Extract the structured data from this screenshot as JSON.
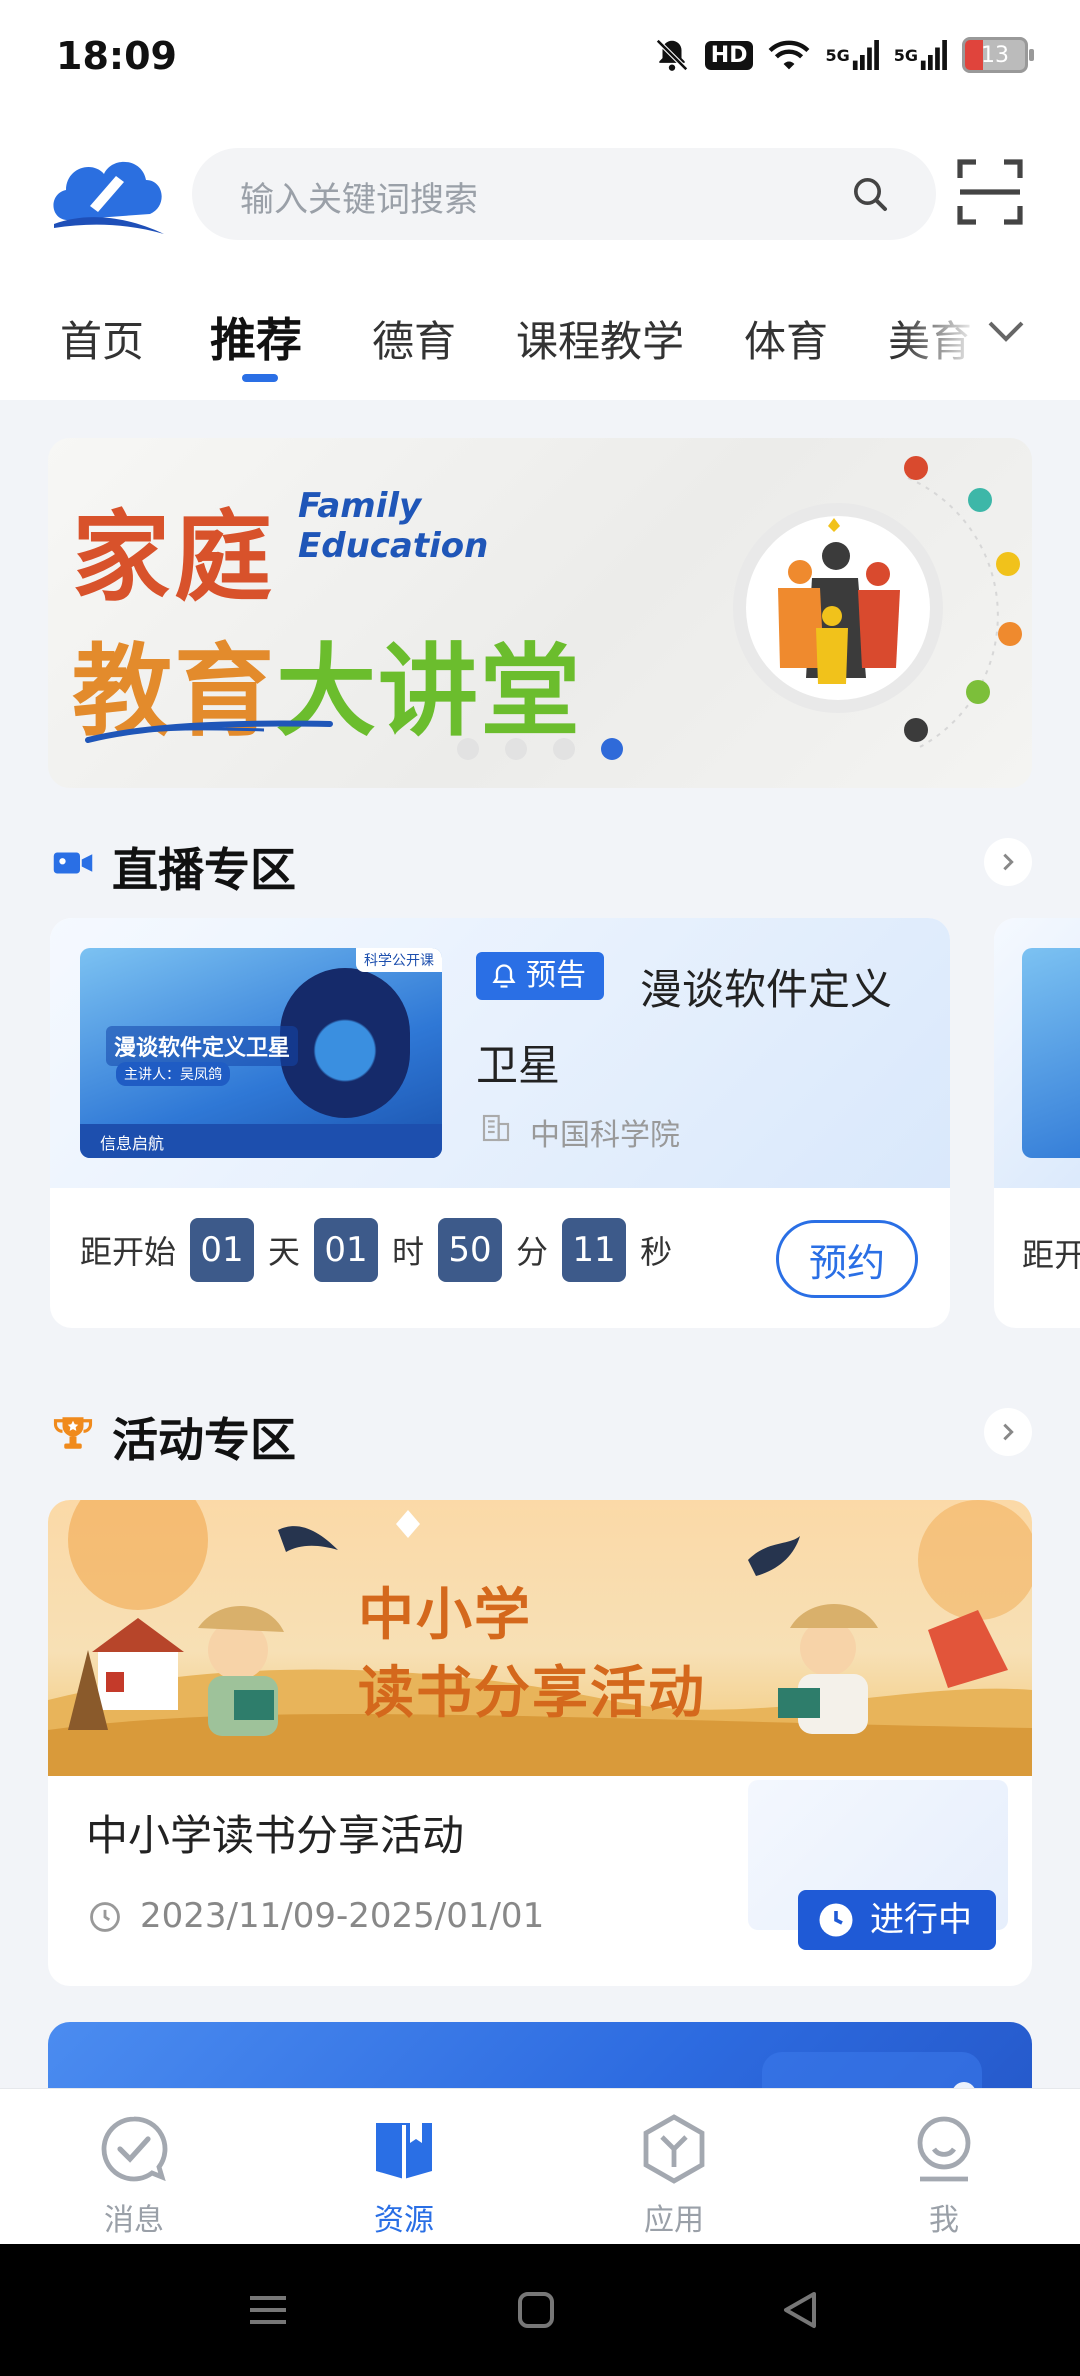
{
  "status_bar": {
    "time": "18:09",
    "hd_label": "HD",
    "net1": "5G",
    "net2": "5G",
    "battery": "13"
  },
  "header": {
    "search_placeholder": "输入关键词搜索"
  },
  "tabs": [
    {
      "label": "首页"
    },
    {
      "label": "推荐"
    },
    {
      "label": "德育"
    },
    {
      "label": "课程教学"
    },
    {
      "label": "体育"
    },
    {
      "label": "美育"
    }
  ],
  "banner": {
    "title_line1": "家庭",
    "title_line2a": "教育",
    "title_line2b": "大讲堂",
    "english_line1": "Family",
    "english_line2": "Education"
  },
  "live_section": {
    "title": "直播专区",
    "card": {
      "badge": "预告",
      "title": "漫谈软件定义卫星",
      "org": "中国科学院",
      "thumb_title": "漫谈软件定义卫星",
      "thumb_lecturer": "主讲人：吴凤鸽",
      "thumb_footer": "信息启航",
      "thumb_tag": "科学公开课",
      "countdown_prefix": "距开始",
      "days": "01",
      "days_unit": "天",
      "hours": "01",
      "hours_unit": "时",
      "minutes": "50",
      "minutes_unit": "分",
      "seconds": "11",
      "seconds_unit": "秒",
      "reserve_label": "预约"
    },
    "card2_prefix": "距开"
  },
  "activity_section": {
    "title": "活动专区",
    "card": {
      "image_line1": "中小学",
      "image_line2": "读书分享活动",
      "title": "中小学读书分享活动",
      "date_range": "2023/11/09-2025/01/01",
      "status": "进行中"
    }
  },
  "bottom_nav": [
    {
      "label": "消息",
      "icon": "message-check-icon"
    },
    {
      "label": "资源",
      "icon": "book-icon"
    },
    {
      "label": "应用",
      "icon": "app-hexagon-icon"
    },
    {
      "label": "我",
      "icon": "profile-icon"
    }
  ],
  "colors": {
    "accent": "#2a6fe5",
    "countdown_bg": "#3d5a8a",
    "status_bg": "#1f5ad6"
  }
}
